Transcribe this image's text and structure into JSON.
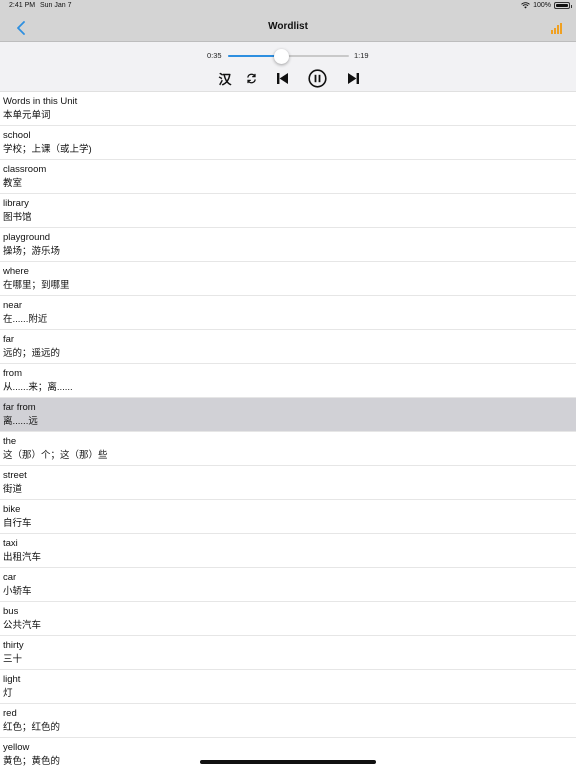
{
  "status_bar": {
    "time": "2:41 PM",
    "date": "Sun Jan 7",
    "battery": "100%",
    "battery_level": 1.0
  },
  "nav": {
    "title": "Wordlist",
    "back_icon": "chevron-left-icon",
    "chart_icon": "bar-chart-icon",
    "accent_color": "#2e8fe0",
    "chart_color": "#f0a020"
  },
  "player": {
    "current_time": "0:35",
    "total_time": "1:19",
    "progress": 0.44,
    "han_label": "汉"
  },
  "selected_index": 9,
  "words": [
    {
      "en": "Words in this Unit",
      "cn": "本单元单词"
    },
    {
      "en": "school",
      "cn": "学校；上课（或上学)"
    },
    {
      "en": "classroom",
      "cn": "教室"
    },
    {
      "en": "library",
      "cn": "图书馆"
    },
    {
      "en": "playground",
      "cn": "操场；游乐场"
    },
    {
      "en": "where",
      "cn": "在哪里；到哪里"
    },
    {
      "en": "near",
      "cn": "在......附近"
    },
    {
      "en": "far",
      "cn": "远的；遥远的"
    },
    {
      "en": "from",
      "cn": "从......来；离......"
    },
    {
      "en": "far from",
      "cn": "离......远"
    },
    {
      "en": "the",
      "cn": "这（那）个；这（那）些"
    },
    {
      "en": "street",
      "cn": "街道"
    },
    {
      "en": "bike",
      "cn": "自行车"
    },
    {
      "en": "taxi",
      "cn": "出租汽车"
    },
    {
      "en": "car",
      "cn": "小轿车"
    },
    {
      "en": "bus",
      "cn": "公共汽车"
    },
    {
      "en": "thirty",
      "cn": "三十"
    },
    {
      "en": "light",
      "cn": "灯"
    },
    {
      "en": "red",
      "cn": "红色；红色的"
    },
    {
      "en": "yellow",
      "cn": "黄色；黄色的"
    }
  ]
}
